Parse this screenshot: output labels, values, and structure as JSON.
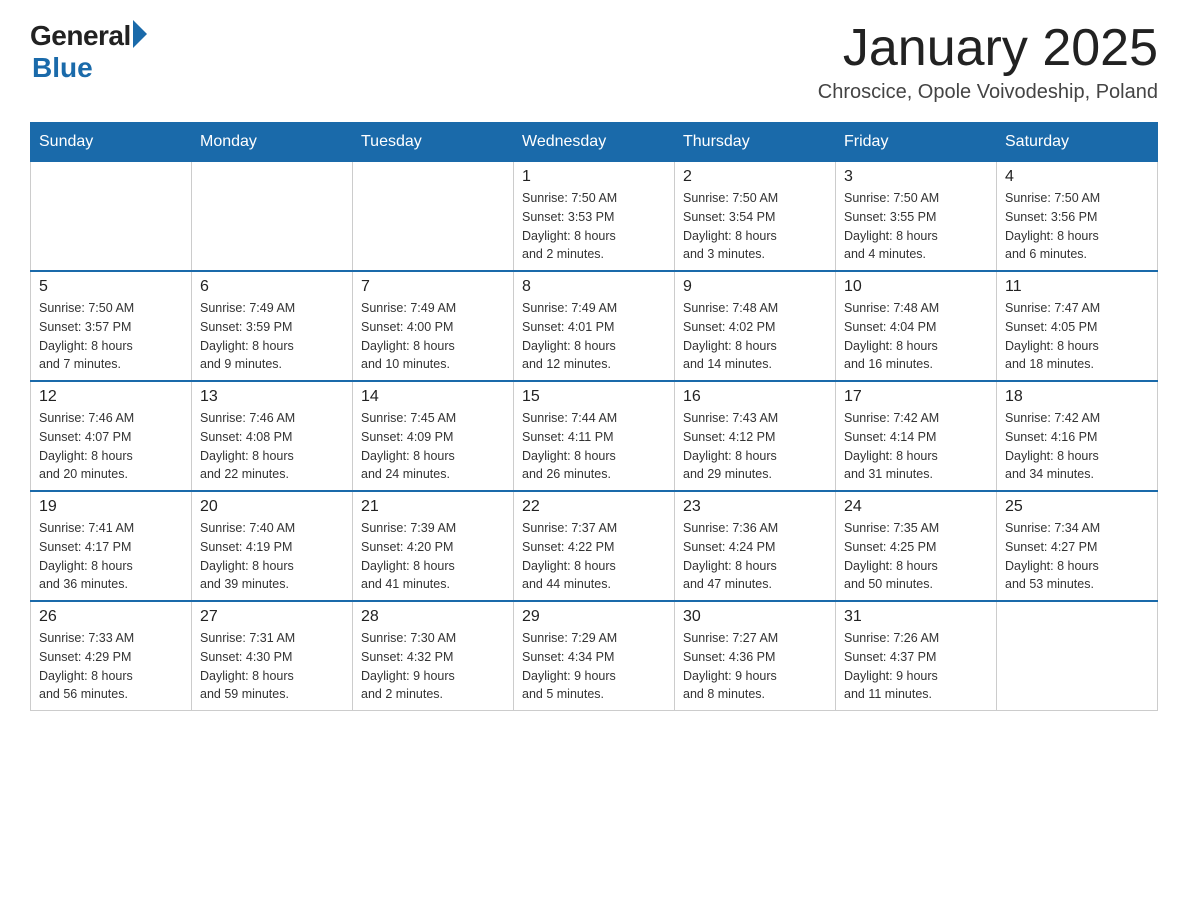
{
  "header": {
    "logo_general": "General",
    "logo_blue": "Blue",
    "title": "January 2025",
    "subtitle": "Chroscice, Opole Voivodeship, Poland"
  },
  "days_of_week": [
    "Sunday",
    "Monday",
    "Tuesday",
    "Wednesday",
    "Thursday",
    "Friday",
    "Saturday"
  ],
  "weeks": [
    [
      {
        "day": "",
        "info": ""
      },
      {
        "day": "",
        "info": ""
      },
      {
        "day": "",
        "info": ""
      },
      {
        "day": "1",
        "info": "Sunrise: 7:50 AM\nSunset: 3:53 PM\nDaylight: 8 hours\nand 2 minutes."
      },
      {
        "day": "2",
        "info": "Sunrise: 7:50 AM\nSunset: 3:54 PM\nDaylight: 8 hours\nand 3 minutes."
      },
      {
        "day": "3",
        "info": "Sunrise: 7:50 AM\nSunset: 3:55 PM\nDaylight: 8 hours\nand 4 minutes."
      },
      {
        "day": "4",
        "info": "Sunrise: 7:50 AM\nSunset: 3:56 PM\nDaylight: 8 hours\nand 6 minutes."
      }
    ],
    [
      {
        "day": "5",
        "info": "Sunrise: 7:50 AM\nSunset: 3:57 PM\nDaylight: 8 hours\nand 7 minutes."
      },
      {
        "day": "6",
        "info": "Sunrise: 7:49 AM\nSunset: 3:59 PM\nDaylight: 8 hours\nand 9 minutes."
      },
      {
        "day": "7",
        "info": "Sunrise: 7:49 AM\nSunset: 4:00 PM\nDaylight: 8 hours\nand 10 minutes."
      },
      {
        "day": "8",
        "info": "Sunrise: 7:49 AM\nSunset: 4:01 PM\nDaylight: 8 hours\nand 12 minutes."
      },
      {
        "day": "9",
        "info": "Sunrise: 7:48 AM\nSunset: 4:02 PM\nDaylight: 8 hours\nand 14 minutes."
      },
      {
        "day": "10",
        "info": "Sunrise: 7:48 AM\nSunset: 4:04 PM\nDaylight: 8 hours\nand 16 minutes."
      },
      {
        "day": "11",
        "info": "Sunrise: 7:47 AM\nSunset: 4:05 PM\nDaylight: 8 hours\nand 18 minutes."
      }
    ],
    [
      {
        "day": "12",
        "info": "Sunrise: 7:46 AM\nSunset: 4:07 PM\nDaylight: 8 hours\nand 20 minutes."
      },
      {
        "day": "13",
        "info": "Sunrise: 7:46 AM\nSunset: 4:08 PM\nDaylight: 8 hours\nand 22 minutes."
      },
      {
        "day": "14",
        "info": "Sunrise: 7:45 AM\nSunset: 4:09 PM\nDaylight: 8 hours\nand 24 minutes."
      },
      {
        "day": "15",
        "info": "Sunrise: 7:44 AM\nSunset: 4:11 PM\nDaylight: 8 hours\nand 26 minutes."
      },
      {
        "day": "16",
        "info": "Sunrise: 7:43 AM\nSunset: 4:12 PM\nDaylight: 8 hours\nand 29 minutes."
      },
      {
        "day": "17",
        "info": "Sunrise: 7:42 AM\nSunset: 4:14 PM\nDaylight: 8 hours\nand 31 minutes."
      },
      {
        "day": "18",
        "info": "Sunrise: 7:42 AM\nSunset: 4:16 PM\nDaylight: 8 hours\nand 34 minutes."
      }
    ],
    [
      {
        "day": "19",
        "info": "Sunrise: 7:41 AM\nSunset: 4:17 PM\nDaylight: 8 hours\nand 36 minutes."
      },
      {
        "day": "20",
        "info": "Sunrise: 7:40 AM\nSunset: 4:19 PM\nDaylight: 8 hours\nand 39 minutes."
      },
      {
        "day": "21",
        "info": "Sunrise: 7:39 AM\nSunset: 4:20 PM\nDaylight: 8 hours\nand 41 minutes."
      },
      {
        "day": "22",
        "info": "Sunrise: 7:37 AM\nSunset: 4:22 PM\nDaylight: 8 hours\nand 44 minutes."
      },
      {
        "day": "23",
        "info": "Sunrise: 7:36 AM\nSunset: 4:24 PM\nDaylight: 8 hours\nand 47 minutes."
      },
      {
        "day": "24",
        "info": "Sunrise: 7:35 AM\nSunset: 4:25 PM\nDaylight: 8 hours\nand 50 minutes."
      },
      {
        "day": "25",
        "info": "Sunrise: 7:34 AM\nSunset: 4:27 PM\nDaylight: 8 hours\nand 53 minutes."
      }
    ],
    [
      {
        "day": "26",
        "info": "Sunrise: 7:33 AM\nSunset: 4:29 PM\nDaylight: 8 hours\nand 56 minutes."
      },
      {
        "day": "27",
        "info": "Sunrise: 7:31 AM\nSunset: 4:30 PM\nDaylight: 8 hours\nand 59 minutes."
      },
      {
        "day": "28",
        "info": "Sunrise: 7:30 AM\nSunset: 4:32 PM\nDaylight: 9 hours\nand 2 minutes."
      },
      {
        "day": "29",
        "info": "Sunrise: 7:29 AM\nSunset: 4:34 PM\nDaylight: 9 hours\nand 5 minutes."
      },
      {
        "day": "30",
        "info": "Sunrise: 7:27 AM\nSunset: 4:36 PM\nDaylight: 9 hours\nand 8 minutes."
      },
      {
        "day": "31",
        "info": "Sunrise: 7:26 AM\nSunset: 4:37 PM\nDaylight: 9 hours\nand 11 minutes."
      },
      {
        "day": "",
        "info": ""
      }
    ]
  ]
}
